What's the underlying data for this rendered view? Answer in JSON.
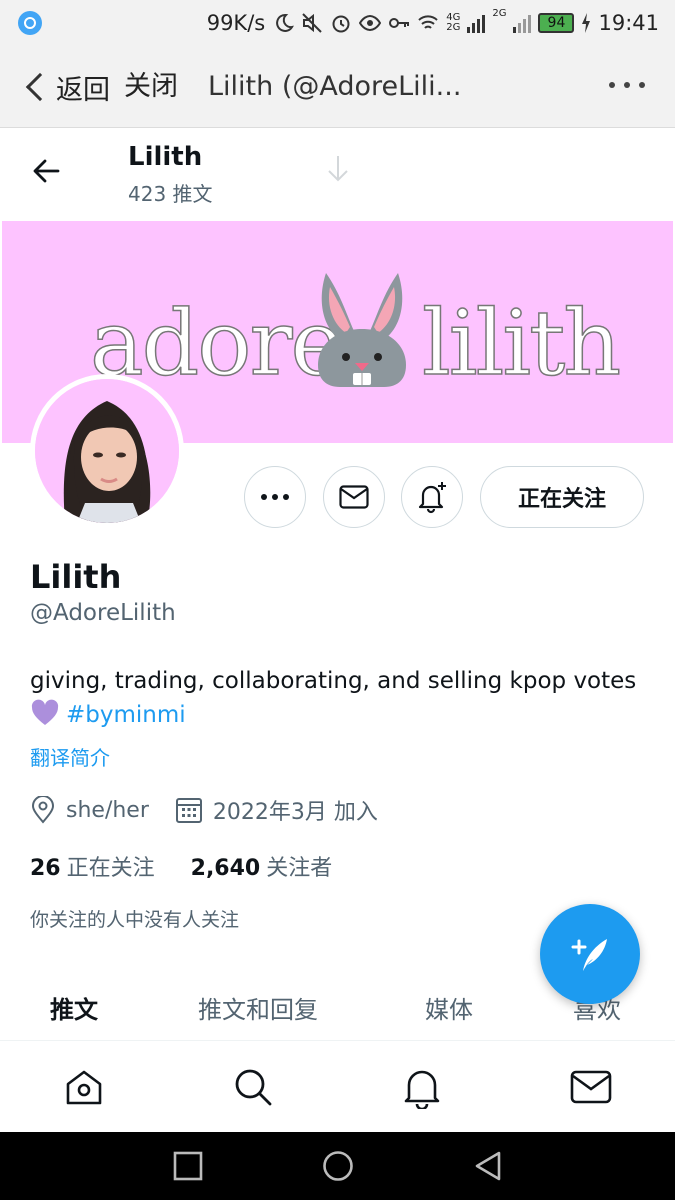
{
  "status_bar": {
    "net_speed": "99K/s",
    "net_type_1": "4G",
    "net_type_2": "2G",
    "battery": "94",
    "time": "19:41"
  },
  "browser": {
    "back_label": "返回",
    "close_label": "关闭",
    "title": "Lilith (@AdoreLili..."
  },
  "header": {
    "name": "Lilith",
    "tweet_count": "423 推文"
  },
  "banner": {
    "text_left": "adore",
    "text_right": "lilith"
  },
  "actions": {
    "follow_label": "正在关注"
  },
  "profile": {
    "name": "Lilith",
    "handle": "@AdoreLilith",
    "bio": "giving, trading, collaborating, and selling kpop votes",
    "bio_tag": "#byminmi",
    "translate": "翻译简介",
    "pronouns": "she/her",
    "joined": "2022年3月 加入",
    "following_count": "26",
    "following_label": "正在关注",
    "followers_count": "2,640",
    "followers_label": "关注者",
    "followers_note": "你关注的人中没有人关注"
  },
  "tabs": [
    "推文",
    "推文和回复",
    "媒体",
    "喜欢"
  ],
  "colors": {
    "accent": "#1d9bf0",
    "banner": "#fdc3ff",
    "text_secondary": "#536471"
  },
  "icons": {
    "bottom_nav": [
      "home-icon",
      "search-icon",
      "notifications-icon",
      "messages-icon"
    ],
    "system_nav": [
      "recents-icon",
      "home-circle-icon",
      "back-triangle-icon"
    ]
  }
}
